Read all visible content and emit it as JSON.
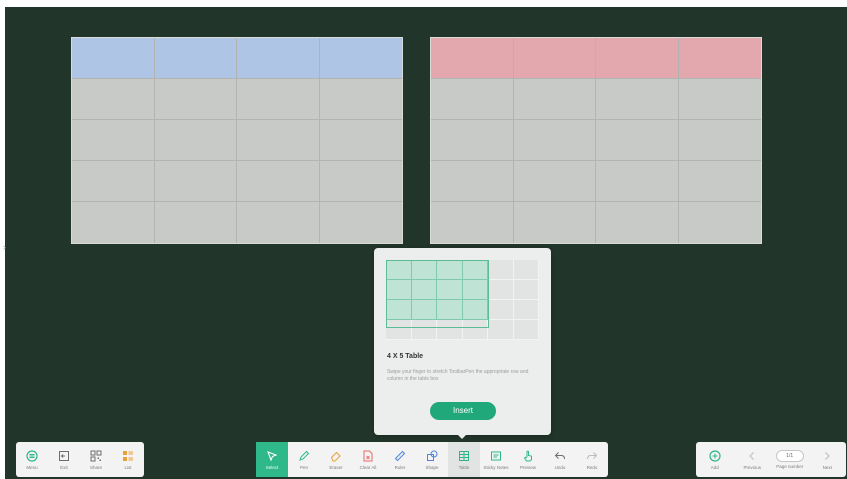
{
  "colors": {
    "board_background": "#22352a",
    "table_body": "#c8cac8",
    "table_header_blue": "#afc5e6",
    "table_header_red": "#e2a8ae",
    "accent": "#21a87a",
    "grid_selection": "#bfe3d5"
  },
  "canvas_tables": [
    {
      "rows": 5,
      "cols": 4,
      "header_color": "#afc5e6"
    },
    {
      "rows": 5,
      "cols": 4,
      "header_color": "#e2a8ae"
    }
  ],
  "popup": {
    "grid_picker": {
      "total_cols": 6,
      "total_rows": 4,
      "selected_cols": 4,
      "selected_rows": 3
    },
    "title": "4 X 5 Table",
    "description": "Swipe your finger to stretch ToolbarPen the appropriate row and column in the table box",
    "insert_label": "Insert"
  },
  "toolbar_left": [
    {
      "label": "Menu",
      "icon": "menu-icon"
    },
    {
      "label": "Exit",
      "icon": "exit-icon"
    },
    {
      "label": "Share",
      "icon": "qr-share-icon"
    },
    {
      "label": "List",
      "icon": "list-icon"
    }
  ],
  "toolbar_main": [
    {
      "label": "Select",
      "icon": "select-cursor-icon",
      "state": "active"
    },
    {
      "label": "Pen",
      "icon": "pen-icon"
    },
    {
      "label": "Eraser",
      "icon": "eraser-icon"
    },
    {
      "label": "Clear All",
      "icon": "clear-all-icon"
    },
    {
      "label": "Ruler",
      "icon": "ruler-icon"
    },
    {
      "label": "Shape",
      "icon": "shape-icon"
    },
    {
      "label": "Table",
      "icon": "table-icon",
      "state": "highlighted"
    },
    {
      "label": "Sticky Notes",
      "icon": "sticky-notes-icon"
    },
    {
      "label": "Preview",
      "icon": "preview-icon"
    },
    {
      "label": "Undo",
      "icon": "undo-icon"
    },
    {
      "label": "Redo",
      "icon": "redo-icon"
    }
  ],
  "toolbar_right": {
    "add_label": "Add",
    "previous_label": "Previous",
    "page_number_label": "Page number",
    "page_value": "1/1",
    "next_label": "Next"
  }
}
